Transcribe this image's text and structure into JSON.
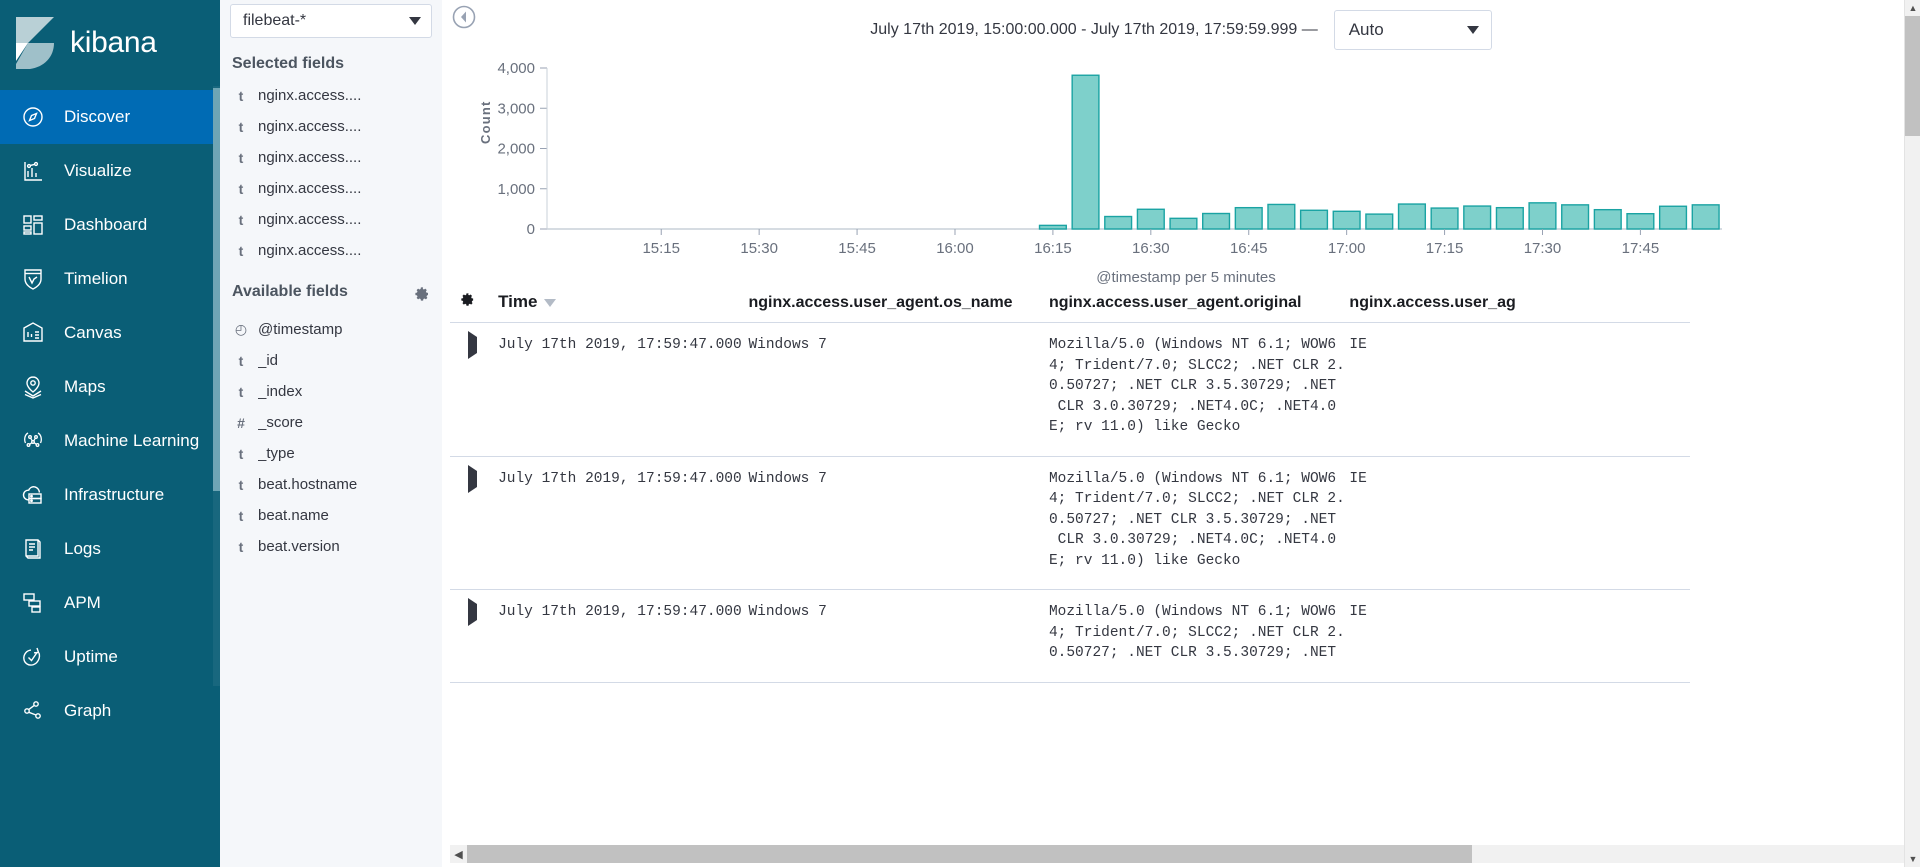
{
  "brand": {
    "name": "kibana",
    "logo_icon": "kibana-logo-icon"
  },
  "nav": {
    "items": [
      {
        "label": "Discover",
        "icon": "compass-icon",
        "active": true
      },
      {
        "label": "Visualize",
        "icon": "bar-chart-icon",
        "active": false
      },
      {
        "label": "Dashboard",
        "icon": "dashboard-grid-icon",
        "active": false
      },
      {
        "label": "Timelion",
        "icon": "timelion-shield-icon",
        "active": false
      },
      {
        "label": "Canvas",
        "icon": "canvas-banner-icon",
        "active": false
      },
      {
        "label": "Maps",
        "icon": "map-pin-layers-icon",
        "active": false
      },
      {
        "label": "Machine Learning",
        "icon": "machine-learning-icon",
        "active": false
      },
      {
        "label": "Infrastructure",
        "icon": "infrastructure-icon",
        "active": false
      },
      {
        "label": "Logs",
        "icon": "logs-scroll-icon",
        "active": false
      },
      {
        "label": "APM",
        "icon": "apm-icon",
        "active": false
      },
      {
        "label": "Uptime",
        "icon": "uptime-check-icon",
        "active": false
      },
      {
        "label": "Graph",
        "icon": "graph-nodes-icon",
        "active": false
      }
    ]
  },
  "sidebar": {
    "index_pattern": {
      "value": "filebeat-*",
      "caret_icon": "chevron-down-icon"
    },
    "collapse_icon": "collapse-left-icon",
    "selected_fields_heading": "Selected fields",
    "selected_fields": [
      {
        "type": "t",
        "name": "nginx.access...."
      },
      {
        "type": "t",
        "name": "nginx.access...."
      },
      {
        "type": "t",
        "name": "nginx.access...."
      },
      {
        "type": "t",
        "name": "nginx.access...."
      },
      {
        "type": "t",
        "name": "nginx.access...."
      },
      {
        "type": "t",
        "name": "nginx.access...."
      }
    ],
    "available_fields_heading": "Available fields",
    "available_fields_gear_icon": "gear-icon",
    "available_fields": [
      {
        "type": "◴",
        "name": "@timestamp"
      },
      {
        "type": "t",
        "name": "_id"
      },
      {
        "type": "t",
        "name": "_index"
      },
      {
        "type": "#",
        "name": "_score"
      },
      {
        "type": "t",
        "name": "_type"
      },
      {
        "type": "t",
        "name": "beat.hostname"
      },
      {
        "type": "t",
        "name": "beat.name"
      },
      {
        "type": "t",
        "name": "beat.version"
      }
    ]
  },
  "toolbar": {
    "time_range": "July 17th 2019, 15:00:00.000 - July 17th 2019, 17:59:59.999 —",
    "interval_value": "Auto",
    "interval_caret_icon": "chevron-down-icon"
  },
  "chart_data": {
    "type": "bar",
    "title": "",
    "xlabel": "@timestamp per 5 minutes",
    "ylabel": "Count",
    "ylim": [
      0,
      4000
    ],
    "yticks": [
      "0",
      "1,000",
      "2,000",
      "3,000",
      "4,000"
    ],
    "ytick_values": [
      0,
      1000,
      2000,
      3000,
      4000
    ],
    "xticks": [
      "15:15",
      "15:30",
      "15:45",
      "16:00",
      "16:15",
      "16:30",
      "16:45",
      "17:00",
      "17:15",
      "17:30",
      "17:45"
    ],
    "bar_color": "#7ed0cb",
    "bar_stroke": "#1aa3a3",
    "grid": false,
    "legend": "none",
    "categories": [
      "15:00",
      "15:05",
      "15:10",
      "15:15",
      "15:20",
      "15:25",
      "15:30",
      "15:35",
      "15:40",
      "15:45",
      "15:50",
      "15:55",
      "16:00",
      "16:05",
      "16:10",
      "16:15",
      "16:20",
      "16:25",
      "16:30",
      "16:35",
      "16:40",
      "16:45",
      "16:50",
      "16:55",
      "17:00",
      "17:05",
      "17:10",
      "17:15",
      "17:20",
      "17:25",
      "17:30",
      "17:35",
      "17:40",
      "17:45",
      "17:50",
      "17:55"
    ],
    "values": [
      0,
      0,
      0,
      0,
      0,
      0,
      0,
      0,
      0,
      0,
      0,
      0,
      0,
      0,
      0,
      90,
      3820,
      310,
      490,
      265,
      385,
      530,
      610,
      465,
      440,
      370,
      620,
      520,
      570,
      530,
      650,
      600,
      480,
      380,
      565,
      600
    ]
  },
  "table": {
    "gear_icon": "gear-icon",
    "columns": [
      {
        "key": "time",
        "label": "Time",
        "sortable": true,
        "sort_icon": "sort-caret-icon"
      },
      {
        "key": "os_name",
        "label": "nginx.access.user_agent.os_name"
      },
      {
        "key": "original",
        "label": "nginx.access.user_agent.original"
      },
      {
        "key": "name",
        "label": "nginx.access.user_ag"
      }
    ],
    "rows": [
      {
        "expand_icon": "expand-row-icon",
        "time": "July 17th 2019, 17:59:47.000",
        "os_name": "Windows 7",
        "original": "Mozilla/5.0 (Windows NT 6.1; WOW6\n4; Trident/7.0; SLCC2; .NET CLR 2.\n0.50727; .NET CLR 3.5.30729; .NET\n CLR 3.0.30729; .NET4.0C; .NET4.0\nE; rv 11.0) like Gecko",
        "name": "IE"
      },
      {
        "expand_icon": "expand-row-icon",
        "time": "July 17th 2019, 17:59:47.000",
        "os_name": "Windows 7",
        "original": "Mozilla/5.0 (Windows NT 6.1; WOW6\n4; Trident/7.0; SLCC2; .NET CLR 2.\n0.50727; .NET CLR 3.5.30729; .NET\n CLR 3.0.30729; .NET4.0C; .NET4.0\nE; rv 11.0) like Gecko",
        "name": "IE"
      },
      {
        "expand_icon": "expand-row-icon",
        "time": "July 17th 2019, 17:59:47.000",
        "os_name": "Windows 7",
        "original": "Mozilla/5.0 (Windows NT 6.1; WOW6\n4; Trident/7.0; SLCC2; .NET CLR 2.\n0.50727; .NET CLR 3.5.30729; .NET",
        "name": "IE"
      }
    ]
  },
  "scrollbars": {
    "horizontal_left_arrow": "◀",
    "horizontal_right_arrow": "▶",
    "vertical_up_arrow": "▲",
    "vertical_down_arrow": "▼"
  }
}
